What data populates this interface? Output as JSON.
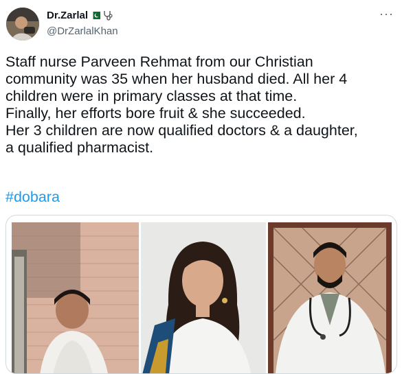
{
  "tweet": {
    "author": {
      "display_name": "Dr.Zarlal",
      "name_emoji": "🇵🇰 🩺",
      "handle": "@DrZarlalKhan",
      "avatar_icon": "user-avatar"
    },
    "more_label": "···",
    "text_lines": [
      "Staff nurse Parveen Rehmat from our Christian",
      "community was 35 when her husband died. All her 4",
      "children were in primary classes at that time.",
      "Finally, her efforts bore fruit & she succeeded.",
      "Her 3 children are now qualified doctors & a daughter,",
      "a qualified pharmacist."
    ],
    "hashtag": "#dobara"
  },
  "colors": {
    "text": "#0f1419",
    "secondary": "#536471",
    "link": "#1d9bf0",
    "border": "#cfd9de"
  }
}
